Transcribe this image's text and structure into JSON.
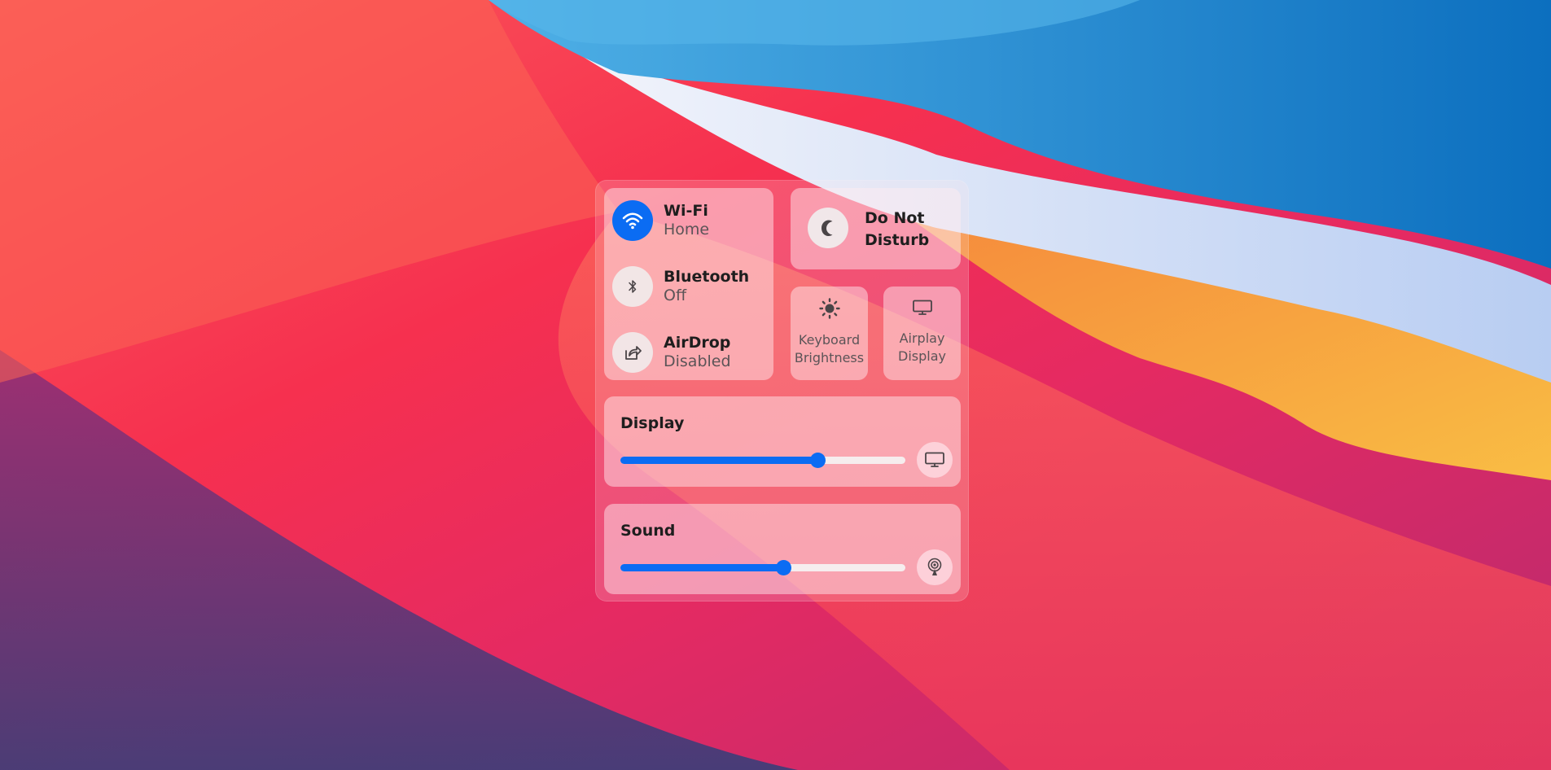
{
  "colors": {
    "accent": "#0b6cf3",
    "text_primary": "#1e1e1e",
    "text_secondary": "#5b5457"
  },
  "control_center": {
    "network": [
      {
        "title": "Wi-Fi",
        "status": "Home",
        "icon": "wifi-icon",
        "active": true
      },
      {
        "title": "Bluetooth",
        "status": "Off",
        "icon": "bluetooth-icon",
        "active": false
      },
      {
        "title": "AirDrop",
        "status": "Disabled",
        "icon": "airdrop-icon",
        "active": false
      }
    ],
    "do_not_disturb": {
      "label": "Do Not Disturb",
      "icon": "moon-icon"
    },
    "keyboard_brightness": {
      "label_line1": "Keyboard",
      "label_line2": "Brightness",
      "icon": "sun-icon"
    },
    "airplay_display": {
      "label_line1": "Airplay",
      "label_line2": "Display",
      "icon": "monitor-icon"
    },
    "display": {
      "title": "Display",
      "level_percent": 69,
      "icon": "monitor-icon"
    },
    "sound": {
      "title": "Sound",
      "level_percent": 57,
      "icon": "airplay-audio-icon"
    }
  }
}
